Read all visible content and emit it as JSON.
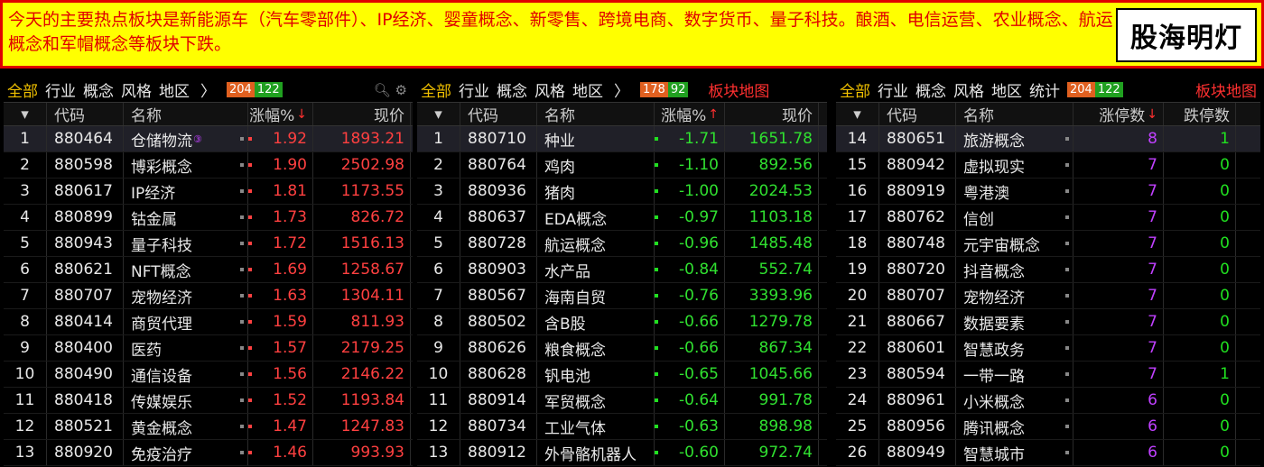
{
  "banner": {
    "text": "今天的主要热点板块是新能源车（汽车零部件）、IP经济、婴童概念、新零售、跨境电商、数字货币、量子科技。酿酒、电信运营、农业概念、航运概念和军帽概念等板块下跌。",
    "brand": "股海明灯"
  },
  "panel1": {
    "tabs": [
      "全部",
      "行业",
      "概念",
      "风格",
      "地区",
      "〉"
    ],
    "count_up": "204",
    "count_down": "122",
    "headers": {
      "code": "代码",
      "name": "名称",
      "pct": "涨幅%",
      "price": "现价"
    },
    "rows": [
      {
        "i": "1",
        "code": "880464",
        "name": "仓储物流",
        "pct": "1.92",
        "price": "1893.21"
      },
      {
        "i": "2",
        "code": "880598",
        "name": "博彩概念",
        "pct": "1.90",
        "price": "2502.98"
      },
      {
        "i": "3",
        "code": "880617",
        "name": "IP经济",
        "pct": "1.81",
        "price": "1173.55"
      },
      {
        "i": "4",
        "code": "880899",
        "name": "钴金属",
        "pct": "1.73",
        "price": "826.72"
      },
      {
        "i": "5",
        "code": "880943",
        "name": "量子科技",
        "pct": "1.72",
        "price": "1516.13"
      },
      {
        "i": "6",
        "code": "880621",
        "name": "NFT概念",
        "pct": "1.69",
        "price": "1258.67"
      },
      {
        "i": "7",
        "code": "880707",
        "name": "宠物经济",
        "pct": "1.63",
        "price": "1304.11"
      },
      {
        "i": "8",
        "code": "880414",
        "name": "商贸代理",
        "pct": "1.59",
        "price": "811.93"
      },
      {
        "i": "9",
        "code": "880400",
        "name": "医药",
        "pct": "1.57",
        "price": "2179.25"
      },
      {
        "i": "10",
        "code": "880490",
        "name": "通信设备",
        "pct": "1.56",
        "price": "2146.22"
      },
      {
        "i": "11",
        "code": "880418",
        "name": "传媒娱乐",
        "pct": "1.52",
        "price": "1193.84"
      },
      {
        "i": "12",
        "code": "880521",
        "name": "黄金概念",
        "pct": "1.47",
        "price": "1247.83"
      },
      {
        "i": "13",
        "code": "880920",
        "name": "免疫治疗",
        "pct": "1.46",
        "price": "993.93"
      }
    ]
  },
  "panel2": {
    "tabs": [
      "全部",
      "行业",
      "概念",
      "风格",
      "地区",
      "〉"
    ],
    "count_up": "178",
    "count_down": "92",
    "map_label": "板块地图",
    "headers": {
      "code": "代码",
      "name": "名称",
      "pct": "涨幅%",
      "price": "现价"
    },
    "rows": [
      {
        "i": "1",
        "code": "880710",
        "name": "种业",
        "pct": "-1.71",
        "price": "1651.78"
      },
      {
        "i": "2",
        "code": "880764",
        "name": "鸡肉",
        "pct": "-1.10",
        "price": "892.56"
      },
      {
        "i": "3",
        "code": "880936",
        "name": "猪肉",
        "pct": "-1.00",
        "price": "2024.53"
      },
      {
        "i": "4",
        "code": "880637",
        "name": "EDA概念",
        "pct": "-0.97",
        "price": "1103.18"
      },
      {
        "i": "5",
        "code": "880728",
        "name": "航运概念",
        "pct": "-0.96",
        "price": "1485.48"
      },
      {
        "i": "6",
        "code": "880903",
        "name": "水产品",
        "pct": "-0.84",
        "price": "552.74"
      },
      {
        "i": "7",
        "code": "880567",
        "name": "海南自贸",
        "pct": "-0.76",
        "price": "3393.96"
      },
      {
        "i": "8",
        "code": "880502",
        "name": "含B股",
        "pct": "-0.66",
        "price": "1279.78"
      },
      {
        "i": "9",
        "code": "880626",
        "name": "粮食概念",
        "pct": "-0.66",
        "price": "867.34"
      },
      {
        "i": "10",
        "code": "880628",
        "name": "钒电池",
        "pct": "-0.65",
        "price": "1045.66"
      },
      {
        "i": "11",
        "code": "880914",
        "name": "军贸概念",
        "pct": "-0.64",
        "price": "991.78"
      },
      {
        "i": "12",
        "code": "880734",
        "name": "工业气体",
        "pct": "-0.63",
        "price": "898.98"
      },
      {
        "i": "13",
        "code": "880912",
        "name": "外骨骼机器人",
        "pct": "-0.60",
        "price": "972.74"
      }
    ]
  },
  "panel3": {
    "tabs": [
      "全部",
      "行业",
      "概念",
      "风格",
      "地区",
      "统计"
    ],
    "count_up": "204",
    "count_down": "122",
    "map_label": "板块地图",
    "headers": {
      "code": "代码",
      "name": "名称",
      "limitup": "涨停数",
      "limitdown": "跌停数"
    },
    "rows": [
      {
        "i": "14",
        "code": "880651",
        "name": "旅游概念",
        "up": "8",
        "down": "1"
      },
      {
        "i": "15",
        "code": "880942",
        "name": "虚拟现实",
        "up": "7",
        "down": "0"
      },
      {
        "i": "16",
        "code": "880919",
        "name": "粤港澳",
        "up": "7",
        "down": "0"
      },
      {
        "i": "17",
        "code": "880762",
        "name": "信创",
        "up": "7",
        "down": "0"
      },
      {
        "i": "18",
        "code": "880748",
        "name": "元宇宙概念",
        "up": "7",
        "down": "0"
      },
      {
        "i": "19",
        "code": "880720",
        "name": "抖音概念",
        "up": "7",
        "down": "0"
      },
      {
        "i": "20",
        "code": "880707",
        "name": "宠物经济",
        "up": "7",
        "down": "0"
      },
      {
        "i": "21",
        "code": "880667",
        "name": "数据要素",
        "up": "7",
        "down": "0"
      },
      {
        "i": "22",
        "code": "880601",
        "name": "智慧政务",
        "up": "7",
        "down": "0"
      },
      {
        "i": "23",
        "code": "880594",
        "name": "一带一路",
        "up": "7",
        "down": "1"
      },
      {
        "i": "24",
        "code": "880961",
        "name": "小米概念",
        "up": "6",
        "down": "0"
      },
      {
        "i": "25",
        "code": "880956",
        "name": "腾讯概念",
        "up": "6",
        "down": "0"
      },
      {
        "i": "26",
        "code": "880949",
        "name": "智慧城市",
        "up": "6",
        "down": "0"
      }
    ]
  },
  "colors": {
    "up": "#ff4040",
    "down": "#30e030",
    "accent": "#f0c000",
    "banner_bg": "#ffff00",
    "banner_text": "#e00000"
  }
}
